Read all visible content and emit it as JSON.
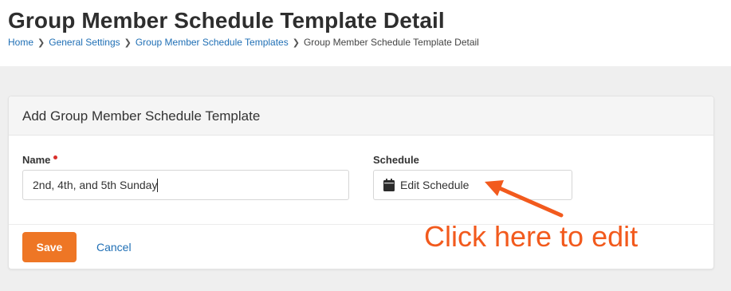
{
  "header": {
    "title": "Group Member Schedule Template Detail",
    "breadcrumb": [
      {
        "label": "Home"
      },
      {
        "label": "General Settings"
      },
      {
        "label": "Group Member Schedule Templates"
      },
      {
        "label": "Group Member Schedule Template Detail"
      }
    ]
  },
  "panel": {
    "title": "Add Group Member Schedule Template",
    "name_label": "Name",
    "name_value": "2nd, 4th, and 5th Sunday",
    "schedule_label": "Schedule",
    "schedule_button": "Edit Schedule",
    "save_label": "Save",
    "cancel_label": "Cancel"
  },
  "annotation": {
    "text": "Click here to edit",
    "color": "#f25a1d"
  },
  "icons": {
    "schedule": "calendar-icon",
    "breadcrumb_separator": "chevron-right-icon"
  },
  "colors": {
    "accent": "#ee7625",
    "link": "#1f6fb5",
    "required": "#d9302b"
  }
}
